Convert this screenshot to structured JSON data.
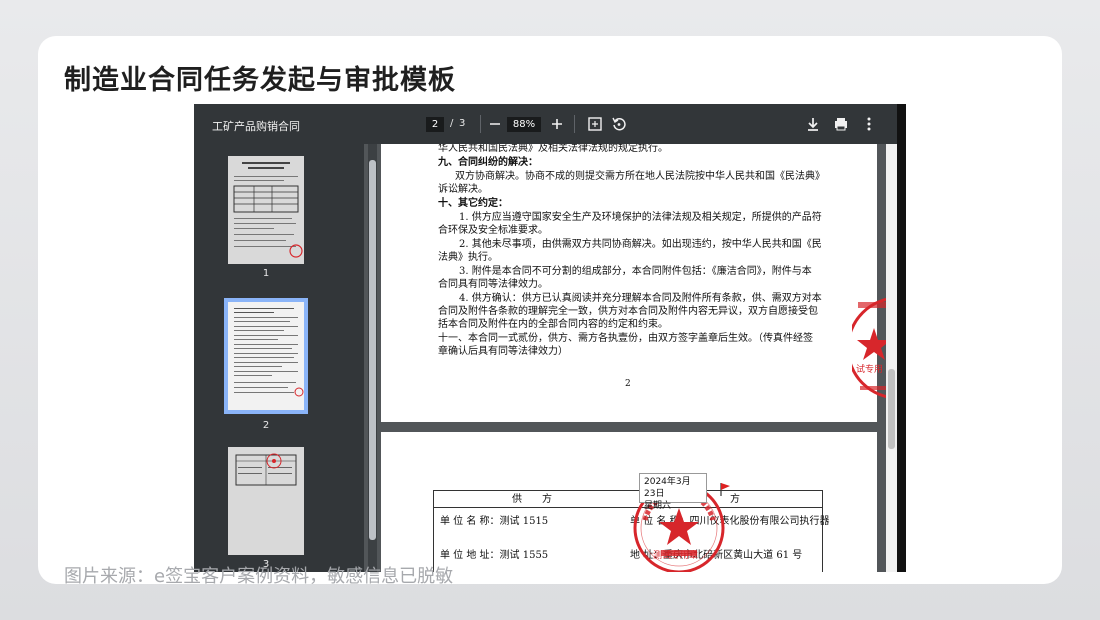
{
  "slide": {
    "title": "制造业合同任务发起与审批模板",
    "footer": "图片来源：e签宝客户案例资料，敏感信息已脱敏"
  },
  "viewer": {
    "doc_title": "工矿产品购销合同",
    "current_page": "2",
    "separator": "/",
    "total_pages": "3",
    "zoom": "88%",
    "icons": {
      "zoom_out": "minus-icon",
      "zoom_in": "plus-icon",
      "fit": "fit-page-icon",
      "rotate": "rotate-icon",
      "download": "download-icon",
      "print": "print-icon",
      "more": "more-vert-icon"
    },
    "thumbnails": [
      {
        "label": "1"
      },
      {
        "label": "2"
      },
      {
        "label": "3"
      }
    ],
    "colors": {
      "toolbar": "#323639",
      "sidebar": "#323639",
      "selected": "#8ab4f8",
      "stamp": "#d7262b"
    }
  },
  "page1": {
    "lines": [
      "华人民共和国民法典》及相关法律法规的规定执行。",
      "九、合同纠纷的解决：",
      "双方协商解决。协商不成的则提交需方所在地人民法院按中华人民共和国《民法典》",
      "诉讼解决。",
      "十、其它约定：",
      "1. 供方应当遵守国家安全生产及环境保护的法律法规及相关规定，所提供的产品符",
      "合环保及安全标准要求。",
      "2. 其他未尽事项，由供需双方共同协商解决。如出现违约，按中华人民共和国《民",
      "法典》执行。",
      "3. 附件是本合同不可分割的组成部分，本合同附件包括：《廉洁合同》，附件与本",
      "合同具有同等法律效力。",
      "4. 供方确认：供方已认真阅读并充分理解本合同及附件所有条款，供、需双方对本",
      "合同及附件各条款的理解完全一致，供方对本合同及附件内容无异议，双方自愿接受包",
      "括本合同及附件在内的全部合同内容的约定和约束。",
      "十一、本合同一式贰份，供方、需方各执壹份，由双方签字盖章后生效。（传真件经签",
      "章确认后具有同等法律效力）"
    ],
    "page_number": "2"
  },
  "page2": {
    "header_left": "供　　方",
    "header_right": "方",
    "row1_left": "单 位 名 称：测试 1515",
    "row1_right": "单 位 名 称：四川仪表化股份有限公司执行器",
    "row2_left": "单 位 地 址：测试 1555",
    "row2_right": "地 址：重庆市北碚新区黄山大道 61 号"
  },
  "stamp": {
    "side_text": "试专用",
    "main_text": "测试专用章",
    "ring_text": "四川仪表化股份有限公司执行器"
  },
  "date_popup": {
    "date": "2024年3月23日",
    "weekday": "星期六"
  }
}
